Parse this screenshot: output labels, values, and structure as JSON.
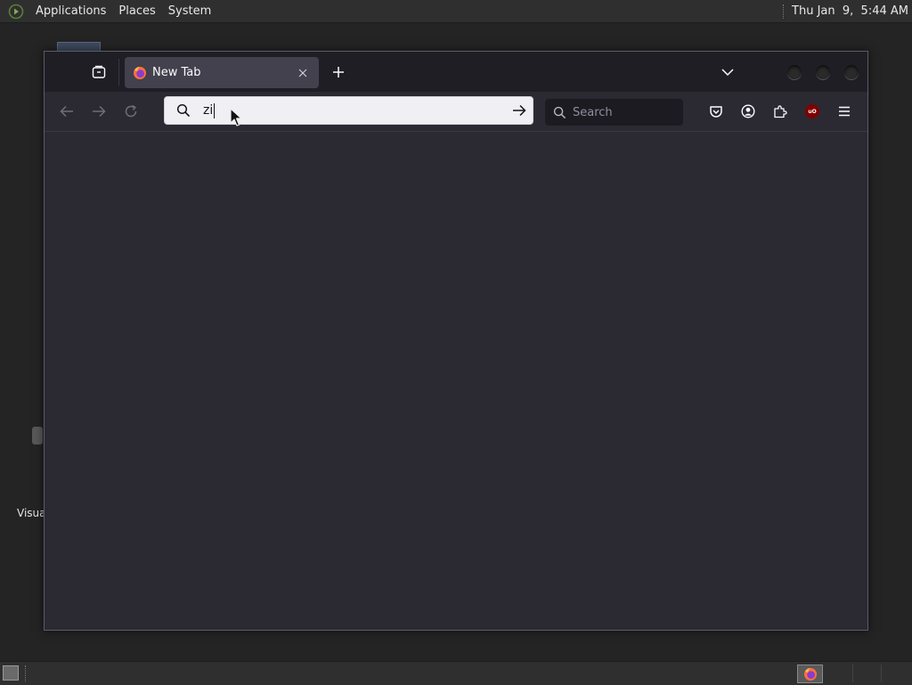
{
  "top_panel": {
    "menus": [
      "Applications",
      "Places",
      "System"
    ],
    "clock": "Thu Jan  9,  5:44 AM"
  },
  "desktop": {
    "icon_label": "Visua"
  },
  "browser": {
    "tab": {
      "title": "New Tab",
      "favicon": "firefox-icon"
    },
    "urlbar": {
      "value": "zi"
    },
    "searchbar": {
      "placeholder": "Search"
    },
    "toolbar_icons": [
      "pocket-icon",
      "account-icon",
      "extensions-icon",
      "ublock-icon",
      "menu-icon"
    ],
    "ublock_label": "uO",
    "colors": {
      "chrome_bg": "#2b2a33",
      "tabbar_bg": "#1f1e25",
      "active_tab": "#42414d",
      "urlbar_bg": "#f0f0f4"
    }
  },
  "bottom_panel": {
    "taskbar": [
      "firefox-icon"
    ]
  }
}
